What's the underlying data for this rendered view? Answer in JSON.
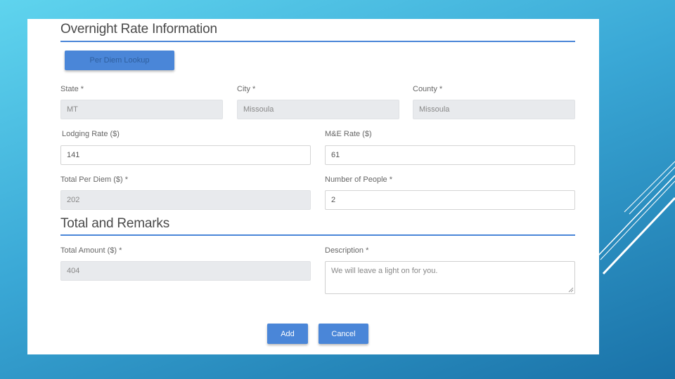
{
  "overnight": {
    "title": "Overnight Rate Information",
    "lookup_button": "Per Diem Lookup",
    "state": {
      "label": "State *",
      "value": "MT"
    },
    "city": {
      "label": "City *",
      "value": "Missoula"
    },
    "county": {
      "label": "County *",
      "value": "Missoula"
    },
    "lodging_rate": {
      "label": "Lodging Rate ($)",
      "value": "141"
    },
    "mie_rate": {
      "label": "M&E Rate ($)",
      "value": "61"
    },
    "total_per_diem": {
      "label": "Total Per Diem ($) *",
      "value": "202"
    },
    "number_of_people": {
      "label": "Number of People *",
      "value": "2"
    }
  },
  "totals": {
    "title": "Total and Remarks",
    "total_amount": {
      "label": "Total Amount ($) *",
      "value": "404"
    },
    "description": {
      "label": "Description *",
      "value": "We will leave a light on for you."
    }
  },
  "actions": {
    "add": "Add",
    "cancel": "Cancel"
  },
  "colors": {
    "accent": "#4a86d8",
    "readonly_bg": "#e8eaed"
  }
}
